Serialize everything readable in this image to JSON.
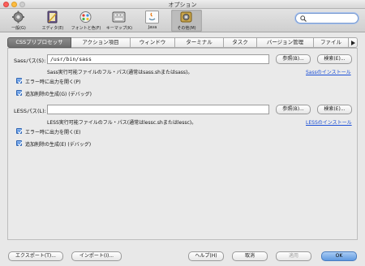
{
  "window": {
    "title": "オプション"
  },
  "toolbar": {
    "items": [
      {
        "label": "一般(G)",
        "icon": "gear-icon"
      },
      {
        "label": "エディタ(E)",
        "icon": "editor-icon"
      },
      {
        "label": "フォントと色(F)",
        "icon": "fonts-colors-icon"
      },
      {
        "label": "キーマップ(K)",
        "icon": "keymap-icon"
      },
      {
        "label": "Java",
        "icon": "java-icon"
      },
      {
        "label": "その他(M)",
        "icon": "miscellaneous-icon",
        "active": true
      }
    ],
    "search": {
      "placeholder": "",
      "value": ""
    }
  },
  "tabs": [
    {
      "label": "CSSプリプロセッサ",
      "active": true
    },
    {
      "label": "アクション項目"
    },
    {
      "label": "ウィンドウ"
    },
    {
      "label": "ターミナル"
    },
    {
      "label": "タスク"
    },
    {
      "label": "バージョン管理"
    },
    {
      "label": "ファイル"
    }
  ],
  "sass": {
    "path_label": "Sassパス(S):",
    "path_value": "/usr/bin/sass",
    "browse": "参照(B)...",
    "search": "検索(E)...",
    "hint": "Sass実行可能ファイルのフル・パス(通常はsass.shまたはsass)。",
    "install_link": "Sassのインストール",
    "checkbox_open_output": {
      "label": "エラー時に出力を開く(P)",
      "checked": true
    },
    "checkbox_generate_extra": {
      "label": "追加削除の生成(G) (デバッグ)",
      "checked": true
    }
  },
  "less": {
    "path_label": "LESSパス(L):",
    "path_value": "",
    "browse": "参照(B)...",
    "search": "検索(E)...",
    "hint": "LESS実行可能ファイルのフル・パス(通常はlessc.shまたはlessc)。",
    "install_link": "LESSのインストール",
    "checkbox_open_output": {
      "label": "エラー時に出力を開く(E)",
      "checked": true
    },
    "checkbox_generate_extra": {
      "label": "追加削除の生成(E) (デバッグ)",
      "checked": true
    }
  },
  "footer": {
    "export": "エクスポート(T)...",
    "import": "インポート(I)...",
    "help": "ヘルプ(H)",
    "cancel": "取消",
    "apply": "適用",
    "ok": "OK"
  },
  "colors": {
    "accent": "#5f9ae0",
    "link": "#1a4ed6",
    "active_tab": "#7a7a7a"
  }
}
